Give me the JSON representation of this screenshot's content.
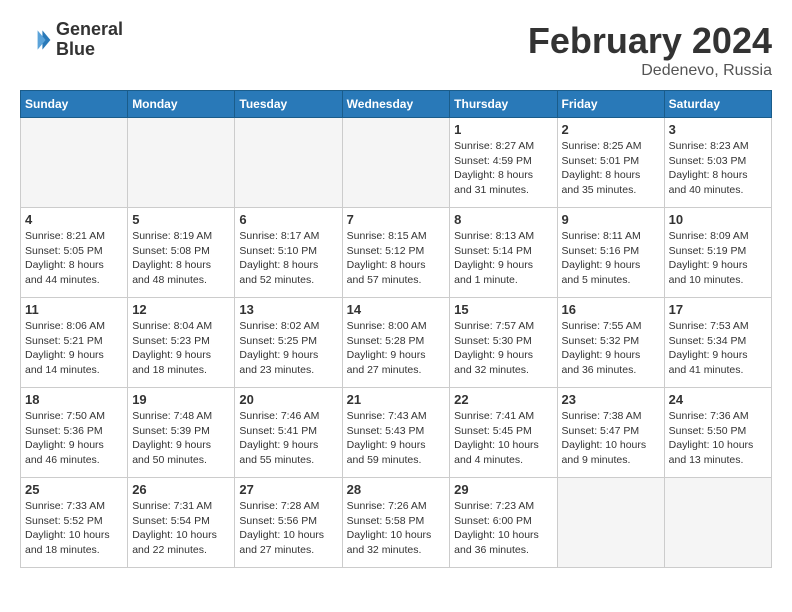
{
  "header": {
    "logo_line1": "General",
    "logo_line2": "Blue",
    "title": "February 2024",
    "subtitle": "Dedenevo, Russia"
  },
  "days_of_week": [
    "Sunday",
    "Monday",
    "Tuesday",
    "Wednesday",
    "Thursday",
    "Friday",
    "Saturday"
  ],
  "weeks": [
    [
      {
        "day": "",
        "info": ""
      },
      {
        "day": "",
        "info": ""
      },
      {
        "day": "",
        "info": ""
      },
      {
        "day": "",
        "info": ""
      },
      {
        "day": "1",
        "info": "Sunrise: 8:27 AM\nSunset: 4:59 PM\nDaylight: 8 hours\nand 31 minutes."
      },
      {
        "day": "2",
        "info": "Sunrise: 8:25 AM\nSunset: 5:01 PM\nDaylight: 8 hours\nand 35 minutes."
      },
      {
        "day": "3",
        "info": "Sunrise: 8:23 AM\nSunset: 5:03 PM\nDaylight: 8 hours\nand 40 minutes."
      }
    ],
    [
      {
        "day": "4",
        "info": "Sunrise: 8:21 AM\nSunset: 5:05 PM\nDaylight: 8 hours\nand 44 minutes."
      },
      {
        "day": "5",
        "info": "Sunrise: 8:19 AM\nSunset: 5:08 PM\nDaylight: 8 hours\nand 48 minutes."
      },
      {
        "day": "6",
        "info": "Sunrise: 8:17 AM\nSunset: 5:10 PM\nDaylight: 8 hours\nand 52 minutes."
      },
      {
        "day": "7",
        "info": "Sunrise: 8:15 AM\nSunset: 5:12 PM\nDaylight: 8 hours\nand 57 minutes."
      },
      {
        "day": "8",
        "info": "Sunrise: 8:13 AM\nSunset: 5:14 PM\nDaylight: 9 hours\nand 1 minute."
      },
      {
        "day": "9",
        "info": "Sunrise: 8:11 AM\nSunset: 5:16 PM\nDaylight: 9 hours\nand 5 minutes."
      },
      {
        "day": "10",
        "info": "Sunrise: 8:09 AM\nSunset: 5:19 PM\nDaylight: 9 hours\nand 10 minutes."
      }
    ],
    [
      {
        "day": "11",
        "info": "Sunrise: 8:06 AM\nSunset: 5:21 PM\nDaylight: 9 hours\nand 14 minutes."
      },
      {
        "day": "12",
        "info": "Sunrise: 8:04 AM\nSunset: 5:23 PM\nDaylight: 9 hours\nand 18 minutes."
      },
      {
        "day": "13",
        "info": "Sunrise: 8:02 AM\nSunset: 5:25 PM\nDaylight: 9 hours\nand 23 minutes."
      },
      {
        "day": "14",
        "info": "Sunrise: 8:00 AM\nSunset: 5:28 PM\nDaylight: 9 hours\nand 27 minutes."
      },
      {
        "day": "15",
        "info": "Sunrise: 7:57 AM\nSunset: 5:30 PM\nDaylight: 9 hours\nand 32 minutes."
      },
      {
        "day": "16",
        "info": "Sunrise: 7:55 AM\nSunset: 5:32 PM\nDaylight: 9 hours\nand 36 minutes."
      },
      {
        "day": "17",
        "info": "Sunrise: 7:53 AM\nSunset: 5:34 PM\nDaylight: 9 hours\nand 41 minutes."
      }
    ],
    [
      {
        "day": "18",
        "info": "Sunrise: 7:50 AM\nSunset: 5:36 PM\nDaylight: 9 hours\nand 46 minutes."
      },
      {
        "day": "19",
        "info": "Sunrise: 7:48 AM\nSunset: 5:39 PM\nDaylight: 9 hours\nand 50 minutes."
      },
      {
        "day": "20",
        "info": "Sunrise: 7:46 AM\nSunset: 5:41 PM\nDaylight: 9 hours\nand 55 minutes."
      },
      {
        "day": "21",
        "info": "Sunrise: 7:43 AM\nSunset: 5:43 PM\nDaylight: 9 hours\nand 59 minutes."
      },
      {
        "day": "22",
        "info": "Sunrise: 7:41 AM\nSunset: 5:45 PM\nDaylight: 10 hours\nand 4 minutes."
      },
      {
        "day": "23",
        "info": "Sunrise: 7:38 AM\nSunset: 5:47 PM\nDaylight: 10 hours\nand 9 minutes."
      },
      {
        "day": "24",
        "info": "Sunrise: 7:36 AM\nSunset: 5:50 PM\nDaylight: 10 hours\nand 13 minutes."
      }
    ],
    [
      {
        "day": "25",
        "info": "Sunrise: 7:33 AM\nSunset: 5:52 PM\nDaylight: 10 hours\nand 18 minutes."
      },
      {
        "day": "26",
        "info": "Sunrise: 7:31 AM\nSunset: 5:54 PM\nDaylight: 10 hours\nand 22 minutes."
      },
      {
        "day": "27",
        "info": "Sunrise: 7:28 AM\nSunset: 5:56 PM\nDaylight: 10 hours\nand 27 minutes."
      },
      {
        "day": "28",
        "info": "Sunrise: 7:26 AM\nSunset: 5:58 PM\nDaylight: 10 hours\nand 32 minutes."
      },
      {
        "day": "29",
        "info": "Sunrise: 7:23 AM\nSunset: 6:00 PM\nDaylight: 10 hours\nand 36 minutes."
      },
      {
        "day": "",
        "info": ""
      },
      {
        "day": "",
        "info": ""
      }
    ]
  ]
}
